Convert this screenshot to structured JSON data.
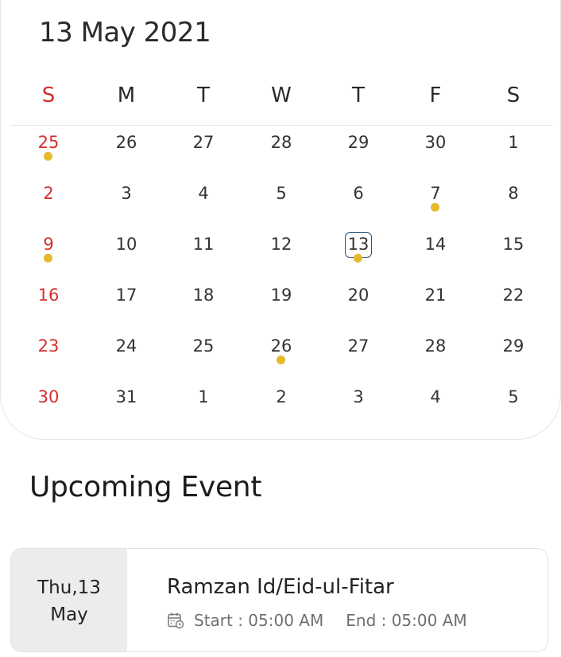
{
  "calendar": {
    "title": "13 May 2021",
    "weekdays": [
      "S",
      "M",
      "T",
      "W",
      "T",
      "F",
      "S"
    ],
    "weeks": [
      [
        "25",
        "26",
        "27",
        "28",
        "29",
        "30",
        "1"
      ],
      [
        "2",
        "3",
        "4",
        "5",
        "6",
        "7",
        "8"
      ],
      [
        "9",
        "10",
        "11",
        "12",
        "13",
        "14",
        "15"
      ],
      [
        "16",
        "17",
        "18",
        "19",
        "20",
        "21",
        "22"
      ],
      [
        "23",
        "24",
        "25",
        "26",
        "27",
        "28",
        "29"
      ],
      [
        "30",
        "31",
        "1",
        "2",
        "3",
        "4",
        "5"
      ]
    ],
    "selected_day": "13",
    "event_markers": [
      "25 Apr",
      "7 May",
      "9 May",
      "13 May",
      "26 May"
    ],
    "colors": {
      "sunday": "#d32f2f",
      "event_dot": "#e6b92b",
      "selected_border": "#2d5679"
    }
  },
  "upcoming": {
    "section_title": "Upcoming Event",
    "events": [
      {
        "date_line1": "Thu,13",
        "date_line2": "May",
        "title": "Ramzan Id/Eid-ul-Fitar",
        "start": "Start : 05:00 AM",
        "end": "End : 05:00 AM",
        "icon": "calendar-clock-icon"
      }
    ]
  }
}
